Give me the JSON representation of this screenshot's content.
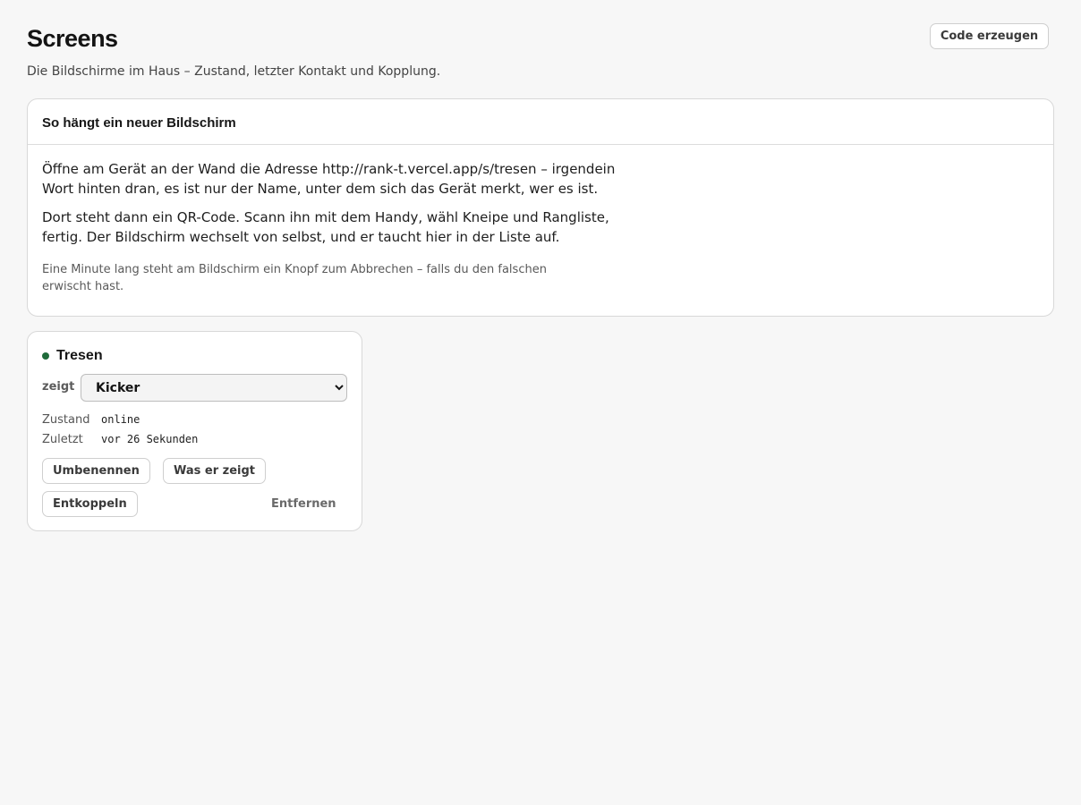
{
  "header": {
    "title": "Screens",
    "subtitle": "Die Bildschirme im Haus – Zustand, letzter Kontakt und Kopplung.",
    "code_button_label": "Code erzeugen"
  },
  "info_card": {
    "title": "So hängt ein neuer Bildschirm",
    "paragraph_1": "Öffne am Gerät an der Wand die Adresse http://rank-t.vercel.app/s/tresen – irgendein Wort hinten dran, es ist nur der Name, unter dem sich das Gerät merkt, wer es ist.",
    "paragraph_2": "Dort steht dann ein QR-Code. Scann ihn mit dem Handy, wähl Kneipe und Rangliste, fertig. Der Bildschirm wechselt von selbst, und er taucht hier in der Liste auf.",
    "note": "Eine Minute lang steht am Bildschirm ein Knopf zum Abbrechen – falls du den falschen erwischt hast."
  },
  "screens": [
    {
      "name": "Tresen",
      "status_color": "#1f6b3a",
      "shows_label": "zeigt",
      "shows_selected": "Kicker",
      "state_label": "Zustand",
      "state_value": "online",
      "last_label": "Zuletzt",
      "last_value": "vor 26 Sekunden",
      "rename_label": "Umbenennen",
      "what_label": "Was er zeigt",
      "unpair_label": "Entkoppeln",
      "remove_label": "Entfernen"
    }
  ]
}
